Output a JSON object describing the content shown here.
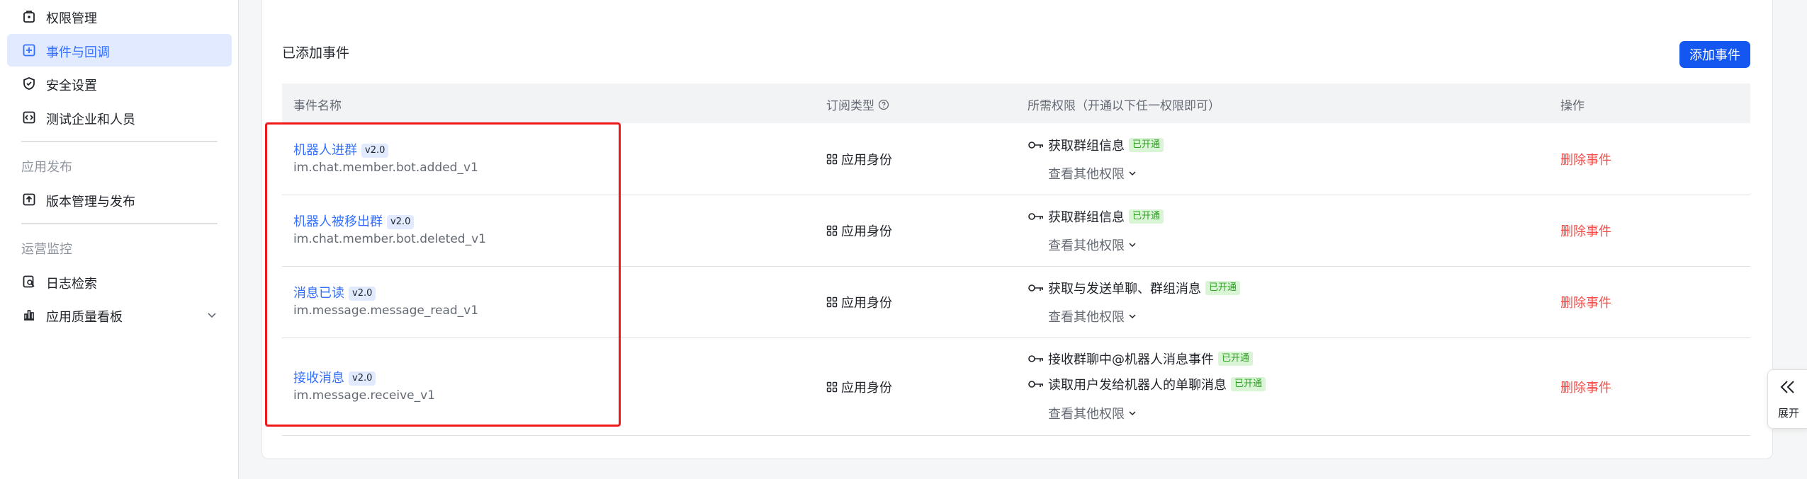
{
  "sidebar": {
    "items": [
      {
        "label": "权限管理",
        "icon": "lock-icon"
      },
      {
        "label": "事件与回调",
        "icon": "event-callback-icon"
      },
      {
        "label": "安全设置",
        "icon": "shield-icon"
      },
      {
        "label": "测试企业和人员",
        "icon": "code-icon"
      }
    ],
    "section_publish": "应用发布",
    "publish_items": [
      {
        "label": "版本管理与发布",
        "icon": "upload-icon"
      }
    ],
    "section_ops": "运营监控",
    "ops_items": [
      {
        "label": "日志检索",
        "icon": "log-search-icon"
      },
      {
        "label": "应用质量看板",
        "icon": "bar-chart-icon"
      }
    ],
    "active_item": "事件与回调"
  },
  "main": {
    "title": "已添加事件",
    "add_button": "添加事件",
    "columns": {
      "name": "事件名称",
      "subscription_type": "订阅类型",
      "permissions": "所需权限（开通以下任一权限即可）",
      "actions": "操作"
    },
    "rows": [
      {
        "name": "机器人进群",
        "version": "v2.0",
        "key": "im.chat.member.bot.added_v1",
        "subscription_type": "应用身份",
        "permissions": [
          {
            "label": "获取群组信息",
            "status": "已开通"
          }
        ],
        "more_label": "查看其他权限",
        "action": "删除事件"
      },
      {
        "name": "机器人被移出群",
        "version": "v2.0",
        "key": "im.chat.member.bot.deleted_v1",
        "subscription_type": "应用身份",
        "permissions": [
          {
            "label": "获取群组信息",
            "status": "已开通"
          }
        ],
        "more_label": "查看其他权限",
        "action": "删除事件"
      },
      {
        "name": "消息已读",
        "version": "v2.0",
        "key": "im.message.message_read_v1",
        "subscription_type": "应用身份",
        "permissions": [
          {
            "label": "获取与发送单聊、群组消息",
            "status": "已开通"
          }
        ],
        "more_label": "查看其他权限",
        "action": "删除事件"
      },
      {
        "name": "接收消息",
        "version": "v2.0",
        "key": "im.message.receive_v1",
        "subscription_type": "应用身份",
        "permissions": [
          {
            "label": "接收群聊中@机器人消息事件",
            "status": "已开通"
          },
          {
            "label": "读取用户发给机器人的单聊消息",
            "status": "已开通"
          }
        ],
        "more_label": "查看其他权限",
        "action": "删除事件"
      }
    ]
  },
  "expand_panel": {
    "label": "展开"
  },
  "colors": {
    "accent": "#3370ff",
    "button": "#1456f0",
    "danger": "#f54a45",
    "success": "#2ea121",
    "highlight": "#f01818"
  }
}
